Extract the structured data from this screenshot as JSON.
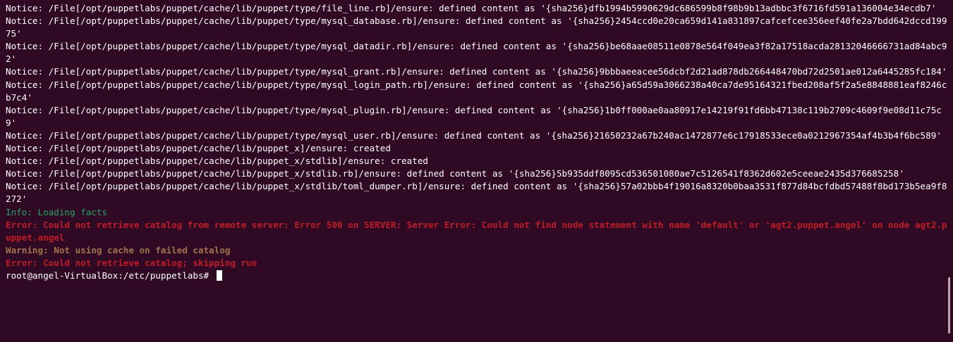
{
  "terminal": {
    "lines": [
      {
        "type": "notice",
        "text": "Notice: /File[/opt/puppetlabs/puppet/cache/lib/puppet/type/file_line.rb]/ensure: defined content as '{sha256}dfb1994b5990629dc686599b8f98b9b13adbbc3f6716fd591a136004e34ecdb7'"
      },
      {
        "type": "notice",
        "text": "Notice: /File[/opt/puppetlabs/puppet/cache/lib/puppet/type/mysql_database.rb]/ensure: defined content as '{sha256}2454ccd0e20ca659d141a831897cafcefcee356eef40fe2a7bdd642dccd19975'"
      },
      {
        "type": "notice",
        "text": "Notice: /File[/opt/puppetlabs/puppet/cache/lib/puppet/type/mysql_datadir.rb]/ensure: defined content as '{sha256}be68aae08511e0878e564f049ea3f82a17518acda28132046666731ad84abc92'"
      },
      {
        "type": "notice",
        "text": "Notice: /File[/opt/puppetlabs/puppet/cache/lib/puppet/type/mysql_grant.rb]/ensure: defined content as '{sha256}9bbbaeeacee56dcbf2d21ad878db266448470bd72d2501ae012a6445285fc184'"
      },
      {
        "type": "notice",
        "text": "Notice: /File[/opt/puppetlabs/puppet/cache/lib/puppet/type/mysql_login_path.rb]/ensure: defined content as '{sha256}a65d59a3066238a40ca7de95164321fbed208af5f2a5e8848881eaf8246cb7c4'"
      },
      {
        "type": "notice",
        "text": "Notice: /File[/opt/puppetlabs/puppet/cache/lib/puppet/type/mysql_plugin.rb]/ensure: defined content as '{sha256}1b0ff000ae0aa80917e14219f91fd6bb47138c119b2709c4609f9e08d11c75c9'"
      },
      {
        "type": "notice",
        "text": "Notice: /File[/opt/puppetlabs/puppet/cache/lib/puppet/type/mysql_user.rb]/ensure: defined content as '{sha256}21650232a67b240ac1472877e6c17918533ece0a0212967354af4b3b4f6bc589'"
      },
      {
        "type": "notice",
        "text": "Notice: /File[/opt/puppetlabs/puppet/cache/lib/puppet_x]/ensure: created"
      },
      {
        "type": "notice",
        "text": "Notice: /File[/opt/puppetlabs/puppet/cache/lib/puppet_x/stdlib]/ensure: created"
      },
      {
        "type": "notice",
        "text": "Notice: /File[/opt/puppetlabs/puppet/cache/lib/puppet_x/stdlib.rb]/ensure: defined content as '{sha256}5b935ddf8095cd536501080ae7c5126541f8362d602e5ceeae2435d376685258'"
      },
      {
        "type": "notice",
        "text": "Notice: /File[/opt/puppetlabs/puppet/cache/lib/puppet_x/stdlib/toml_dumper.rb]/ensure: defined content as '{sha256}57a02bbb4f19016a8320b0baa3531f877d84bcfdbd57488f8bd173b5ea9f8272'"
      },
      {
        "type": "info",
        "text": "Info: Loading facts"
      },
      {
        "type": "error",
        "text": "Error: Could not retrieve catalog from remote server: Error 500 on SERVER: Server Error: Could not find node statement with name 'default' or 'agt2.puppet.angel' on node agt2.puppet.angel"
      },
      {
        "type": "warning",
        "text": "Warning: Not using cache on failed catalog"
      },
      {
        "type": "error",
        "text": "Error: Could not retrieve catalog; skipping run"
      }
    ],
    "prompt": "root@angel-VirtualBox:/etc/puppetlabs# "
  }
}
